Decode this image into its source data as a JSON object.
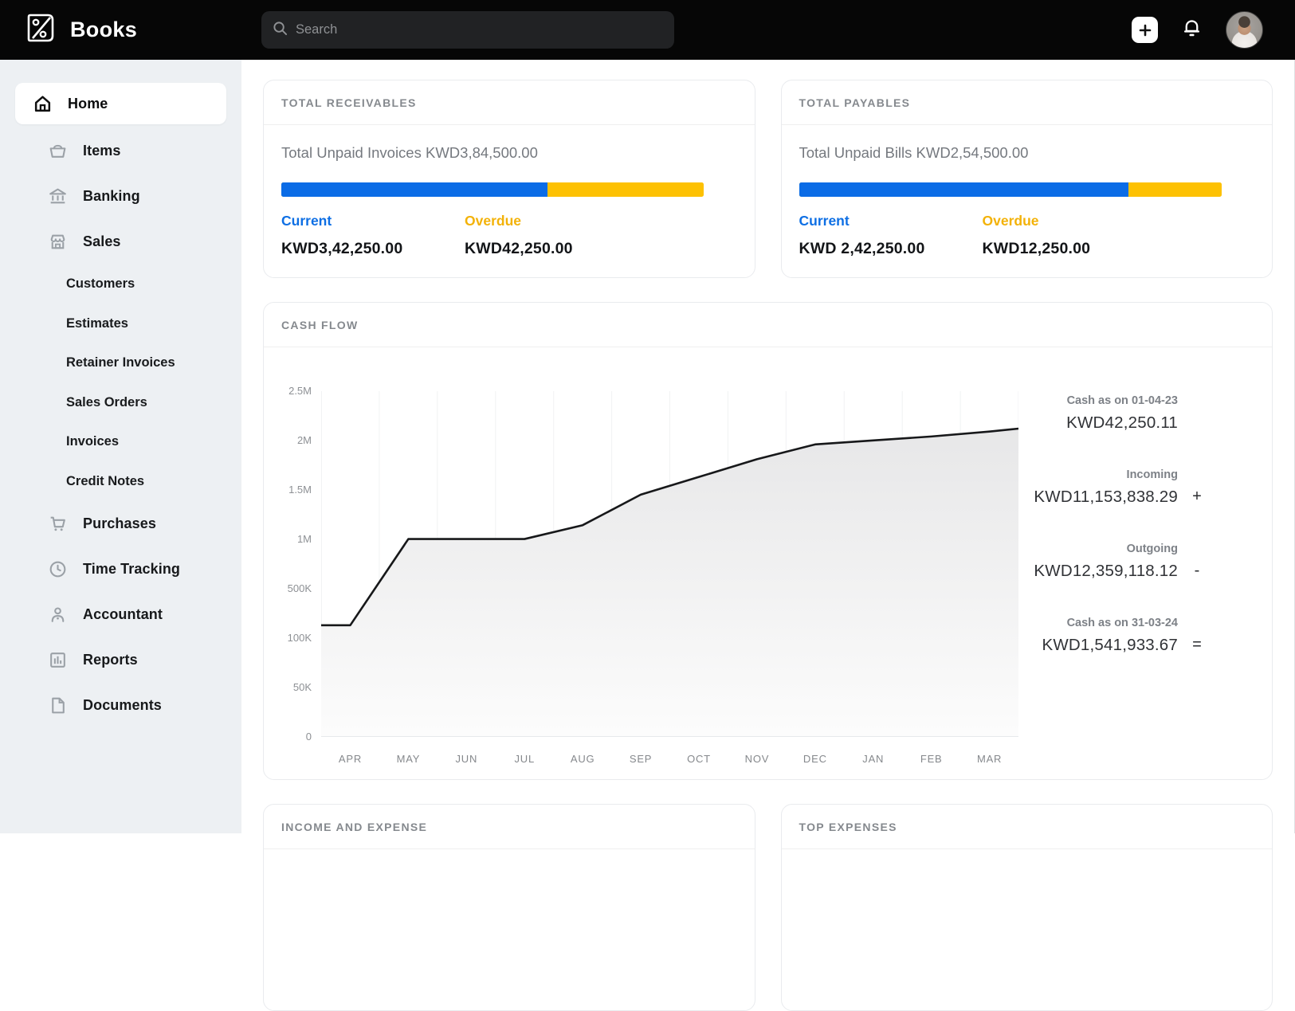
{
  "topbar": {
    "app_name": "Books",
    "search_placeholder": "Search"
  },
  "sidebar": {
    "items": [
      {
        "label": "Home",
        "icon": "home-icon",
        "active": true
      },
      {
        "label": "Items",
        "icon": "basket-icon"
      },
      {
        "label": "Banking",
        "icon": "bank-icon"
      },
      {
        "label": "Sales",
        "icon": "storefront-icon"
      },
      {
        "label": "Customers",
        "sub": true
      },
      {
        "label": "Estimates",
        "sub": true
      },
      {
        "label": "Retainer Invoices",
        "sub": true
      },
      {
        "label": "Sales Orders",
        "sub": true
      },
      {
        "label": "Invoices",
        "sub": true
      },
      {
        "label": "Credit Notes",
        "sub": true
      },
      {
        "label": "Purchases",
        "icon": "cart-icon"
      },
      {
        "label": "Time Tracking",
        "icon": "clock-icon"
      },
      {
        "label": "Accountant",
        "icon": "person-icon"
      },
      {
        "label": "Reports",
        "icon": "bar-chart-icon"
      },
      {
        "label": "Documents",
        "icon": "document-icon"
      }
    ]
  },
  "receivables": {
    "title": "TOTAL RECEIVABLES",
    "summary": "Total Unpaid Invoices KWD3,84,500.00",
    "current_label": "Current",
    "current_amount": "KWD3,42,250.00",
    "overdue_label": "Overdue",
    "overdue_amount": "KWD42,250.00",
    "current_pct": 63
  },
  "payables": {
    "title": "TOTAL PAYABLES",
    "summary": "Total Unpaid Bills KWD2,54,500.00",
    "current_label": "Current",
    "current_amount": "KWD 2,42,250.00",
    "overdue_label": "Overdue",
    "overdue_amount": "KWD12,250.00",
    "current_pct": 78
  },
  "cashflow": {
    "title": "CASH FLOW",
    "stats": [
      {
        "label": "Cash as on 01-04-23",
        "value": "KWD42,250.11",
        "symbol": ""
      },
      {
        "label": "Incoming",
        "value": "KWD11,153,838.29",
        "symbol": "+"
      },
      {
        "label": "Outgoing",
        "value": "KWD12,359,118.12",
        "symbol": "-"
      },
      {
        "label": "Cash as on 31-03-24",
        "value": "KWD1,541,933.67",
        "symbol": "="
      }
    ]
  },
  "chart_data": {
    "type": "area",
    "title": "CASH FLOW",
    "categories": [
      "APR",
      "MAY",
      "JUN",
      "JUL",
      "AUG",
      "SEP",
      "OCT",
      "NOV",
      "DEC",
      "JAN",
      "FEB",
      "MAR"
    ],
    "values": [
      200000,
      1000000,
      1000000,
      1000000,
      1140000,
      1450000,
      1630000,
      1810000,
      1960000,
      2000000,
      2040000,
      2090000
    ],
    "edge_start": 200000,
    "edge_end": 2120000,
    "y_ticks": [
      "0",
      "50K",
      "100K",
      "500K",
      "1M",
      "1.5M",
      "2M",
      "2.5M"
    ],
    "y_tick_values": [
      0,
      50000,
      100000,
      500000,
      1000000,
      1500000,
      2000000,
      2500000
    ],
    "xlabel": "",
    "ylabel": "",
    "grid": "vertical",
    "line_color": "#17181a",
    "legend": "none"
  },
  "bottom_cards": {
    "income_expense_title": "INCOME AND EXPENSE",
    "top_expenses_title": "TOP EXPENSES"
  },
  "colors": {
    "accent_blue": "#0b6ce6",
    "accent_yellow": "#fdc103",
    "topbar_bg": "#060606",
    "sidebar_bg": "#edf0f3"
  }
}
